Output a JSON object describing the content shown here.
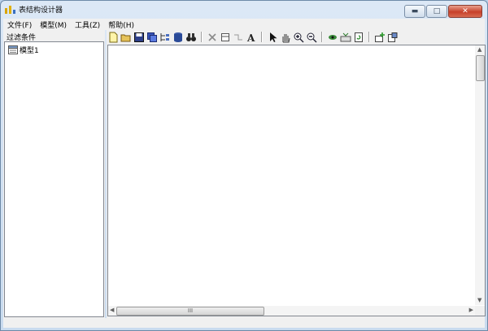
{
  "window": {
    "title": "表结构设计器",
    "buttons": {
      "minimize": "▬",
      "maximize": "□",
      "close": "✕"
    }
  },
  "menu": [
    {
      "label": "文件(F)"
    },
    {
      "label": "模型(M)"
    },
    {
      "label": "工具(Z)"
    },
    {
      "label": "帮助(H)"
    }
  ],
  "left_panel": {
    "filter_label": "过滤条件",
    "tree": [
      {
        "label": "模型1",
        "icon": "model-icon"
      }
    ]
  },
  "toolbar": {
    "groups": [
      [
        "new-file-icon",
        "open-folder-icon",
        "save-icon",
        "copy-icon",
        "tree-layout-icon",
        "database-icon",
        "find-icon"
      ],
      [
        "delete-icon",
        "table-icon",
        "relation-icon",
        "text-icon"
      ],
      [
        "pointer-icon",
        "hand-pan-icon",
        "zoom-in-icon",
        "zoom-out-icon"
      ],
      [
        "eye-icon",
        "sql-icon",
        "refresh-icon"
      ],
      [
        "add-table-icon",
        "properties-icon"
      ]
    ]
  },
  "canvas": {
    "hscroll_grip": "III"
  },
  "colors": {
    "title_gradient_top": "#dce8f6",
    "close_button": "#c7402a",
    "panel_bg": "#f0f0f0"
  }
}
